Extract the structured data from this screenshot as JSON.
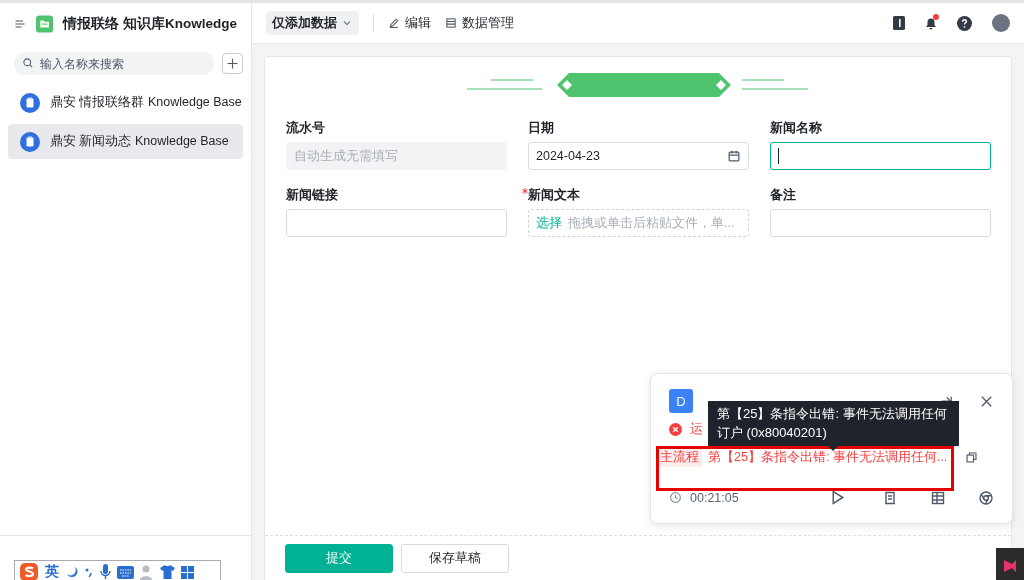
{
  "app": {
    "title": "情报联络 知识库Knowledge"
  },
  "search": {
    "placeholder": "输入名称来搜索"
  },
  "sidebar": {
    "items": [
      {
        "label": "鼎安 情报联络群 Knowledge Base",
        "selected": false
      },
      {
        "label": "鼎安 新闻动态 Knowledge Base",
        "selected": true
      }
    ]
  },
  "toolbar": {
    "view_menu": "仅添加数据",
    "actions": [
      {
        "kind": "edit",
        "label": "编辑"
      },
      {
        "kind": "table",
        "label": "数据管理"
      }
    ]
  },
  "notifications": {
    "unread": true
  },
  "form": {
    "fields": [
      {
        "label": "流水号",
        "kind": "readonly",
        "required": false,
        "placeholder": "自动生成无需填写"
      },
      {
        "label": "日期",
        "kind": "date",
        "required": false,
        "value": "2024-04-23"
      },
      {
        "label": "新闻名称",
        "kind": "text",
        "required": false,
        "focused": true
      },
      {
        "label": "新闻链接",
        "kind": "text",
        "required": false,
        "focused": false
      },
      {
        "label": "新闻文本",
        "kind": "upload",
        "required": true,
        "link": "选择",
        "hint": "拖拽或单击后粘贴文件，单..."
      },
      {
        "label": "备注",
        "kind": "text",
        "required": false,
        "focused": false
      }
    ],
    "buttons": [
      {
        "label": "提交",
        "primary": true
      },
      {
        "label": "保存草稿",
        "primary": false
      }
    ]
  },
  "run_panel": {
    "avatar": "D",
    "status": "运",
    "tag": "主流程",
    "error": "第【25】条指令出错: 事件无法调用任何...",
    "elapsed": "00:21:05",
    "tooltip": "第【25】条指令出错: 事件无法调用任何订户 (0x80040201)"
  },
  "ime": {
    "language": "英"
  }
}
